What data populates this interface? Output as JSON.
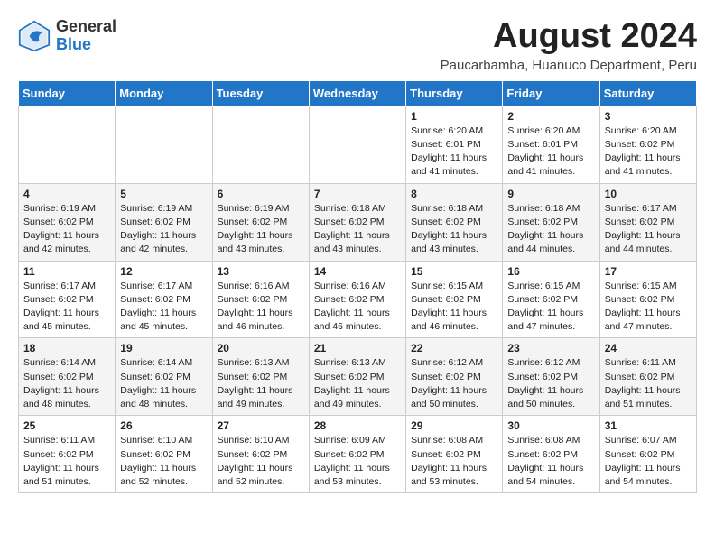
{
  "logo": {
    "general": "General",
    "blue": "Blue"
  },
  "header": {
    "month_year": "August 2024",
    "location": "Paucarbamba, Huanuco Department, Peru"
  },
  "weekdays": [
    "Sunday",
    "Monday",
    "Tuesday",
    "Wednesday",
    "Thursday",
    "Friday",
    "Saturday"
  ],
  "weeks": [
    [
      {
        "day": "",
        "info": ""
      },
      {
        "day": "",
        "info": ""
      },
      {
        "day": "",
        "info": ""
      },
      {
        "day": "",
        "info": ""
      },
      {
        "day": "1",
        "info": "Sunrise: 6:20 AM\nSunset: 6:01 PM\nDaylight: 11 hours\nand 41 minutes."
      },
      {
        "day": "2",
        "info": "Sunrise: 6:20 AM\nSunset: 6:01 PM\nDaylight: 11 hours\nand 41 minutes."
      },
      {
        "day": "3",
        "info": "Sunrise: 6:20 AM\nSunset: 6:02 PM\nDaylight: 11 hours\nand 41 minutes."
      }
    ],
    [
      {
        "day": "4",
        "info": "Sunrise: 6:19 AM\nSunset: 6:02 PM\nDaylight: 11 hours\nand 42 minutes."
      },
      {
        "day": "5",
        "info": "Sunrise: 6:19 AM\nSunset: 6:02 PM\nDaylight: 11 hours\nand 42 minutes."
      },
      {
        "day": "6",
        "info": "Sunrise: 6:19 AM\nSunset: 6:02 PM\nDaylight: 11 hours\nand 43 minutes."
      },
      {
        "day": "7",
        "info": "Sunrise: 6:18 AM\nSunset: 6:02 PM\nDaylight: 11 hours\nand 43 minutes."
      },
      {
        "day": "8",
        "info": "Sunrise: 6:18 AM\nSunset: 6:02 PM\nDaylight: 11 hours\nand 43 minutes."
      },
      {
        "day": "9",
        "info": "Sunrise: 6:18 AM\nSunset: 6:02 PM\nDaylight: 11 hours\nand 44 minutes."
      },
      {
        "day": "10",
        "info": "Sunrise: 6:17 AM\nSunset: 6:02 PM\nDaylight: 11 hours\nand 44 minutes."
      }
    ],
    [
      {
        "day": "11",
        "info": "Sunrise: 6:17 AM\nSunset: 6:02 PM\nDaylight: 11 hours\nand 45 minutes."
      },
      {
        "day": "12",
        "info": "Sunrise: 6:17 AM\nSunset: 6:02 PM\nDaylight: 11 hours\nand 45 minutes."
      },
      {
        "day": "13",
        "info": "Sunrise: 6:16 AM\nSunset: 6:02 PM\nDaylight: 11 hours\nand 46 minutes."
      },
      {
        "day": "14",
        "info": "Sunrise: 6:16 AM\nSunset: 6:02 PM\nDaylight: 11 hours\nand 46 minutes."
      },
      {
        "day": "15",
        "info": "Sunrise: 6:15 AM\nSunset: 6:02 PM\nDaylight: 11 hours\nand 46 minutes."
      },
      {
        "day": "16",
        "info": "Sunrise: 6:15 AM\nSunset: 6:02 PM\nDaylight: 11 hours\nand 47 minutes."
      },
      {
        "day": "17",
        "info": "Sunrise: 6:15 AM\nSunset: 6:02 PM\nDaylight: 11 hours\nand 47 minutes."
      }
    ],
    [
      {
        "day": "18",
        "info": "Sunrise: 6:14 AM\nSunset: 6:02 PM\nDaylight: 11 hours\nand 48 minutes."
      },
      {
        "day": "19",
        "info": "Sunrise: 6:14 AM\nSunset: 6:02 PM\nDaylight: 11 hours\nand 48 minutes."
      },
      {
        "day": "20",
        "info": "Sunrise: 6:13 AM\nSunset: 6:02 PM\nDaylight: 11 hours\nand 49 minutes."
      },
      {
        "day": "21",
        "info": "Sunrise: 6:13 AM\nSunset: 6:02 PM\nDaylight: 11 hours\nand 49 minutes."
      },
      {
        "day": "22",
        "info": "Sunrise: 6:12 AM\nSunset: 6:02 PM\nDaylight: 11 hours\nand 50 minutes."
      },
      {
        "day": "23",
        "info": "Sunrise: 6:12 AM\nSunset: 6:02 PM\nDaylight: 11 hours\nand 50 minutes."
      },
      {
        "day": "24",
        "info": "Sunrise: 6:11 AM\nSunset: 6:02 PM\nDaylight: 11 hours\nand 51 minutes."
      }
    ],
    [
      {
        "day": "25",
        "info": "Sunrise: 6:11 AM\nSunset: 6:02 PM\nDaylight: 11 hours\nand 51 minutes."
      },
      {
        "day": "26",
        "info": "Sunrise: 6:10 AM\nSunset: 6:02 PM\nDaylight: 11 hours\nand 52 minutes."
      },
      {
        "day": "27",
        "info": "Sunrise: 6:10 AM\nSunset: 6:02 PM\nDaylight: 11 hours\nand 52 minutes."
      },
      {
        "day": "28",
        "info": "Sunrise: 6:09 AM\nSunset: 6:02 PM\nDaylight: 11 hours\nand 53 minutes."
      },
      {
        "day": "29",
        "info": "Sunrise: 6:08 AM\nSunset: 6:02 PM\nDaylight: 11 hours\nand 53 minutes."
      },
      {
        "day": "30",
        "info": "Sunrise: 6:08 AM\nSunset: 6:02 PM\nDaylight: 11 hours\nand 54 minutes."
      },
      {
        "day": "31",
        "info": "Sunrise: 6:07 AM\nSunset: 6:02 PM\nDaylight: 11 hours\nand 54 minutes."
      }
    ]
  ]
}
